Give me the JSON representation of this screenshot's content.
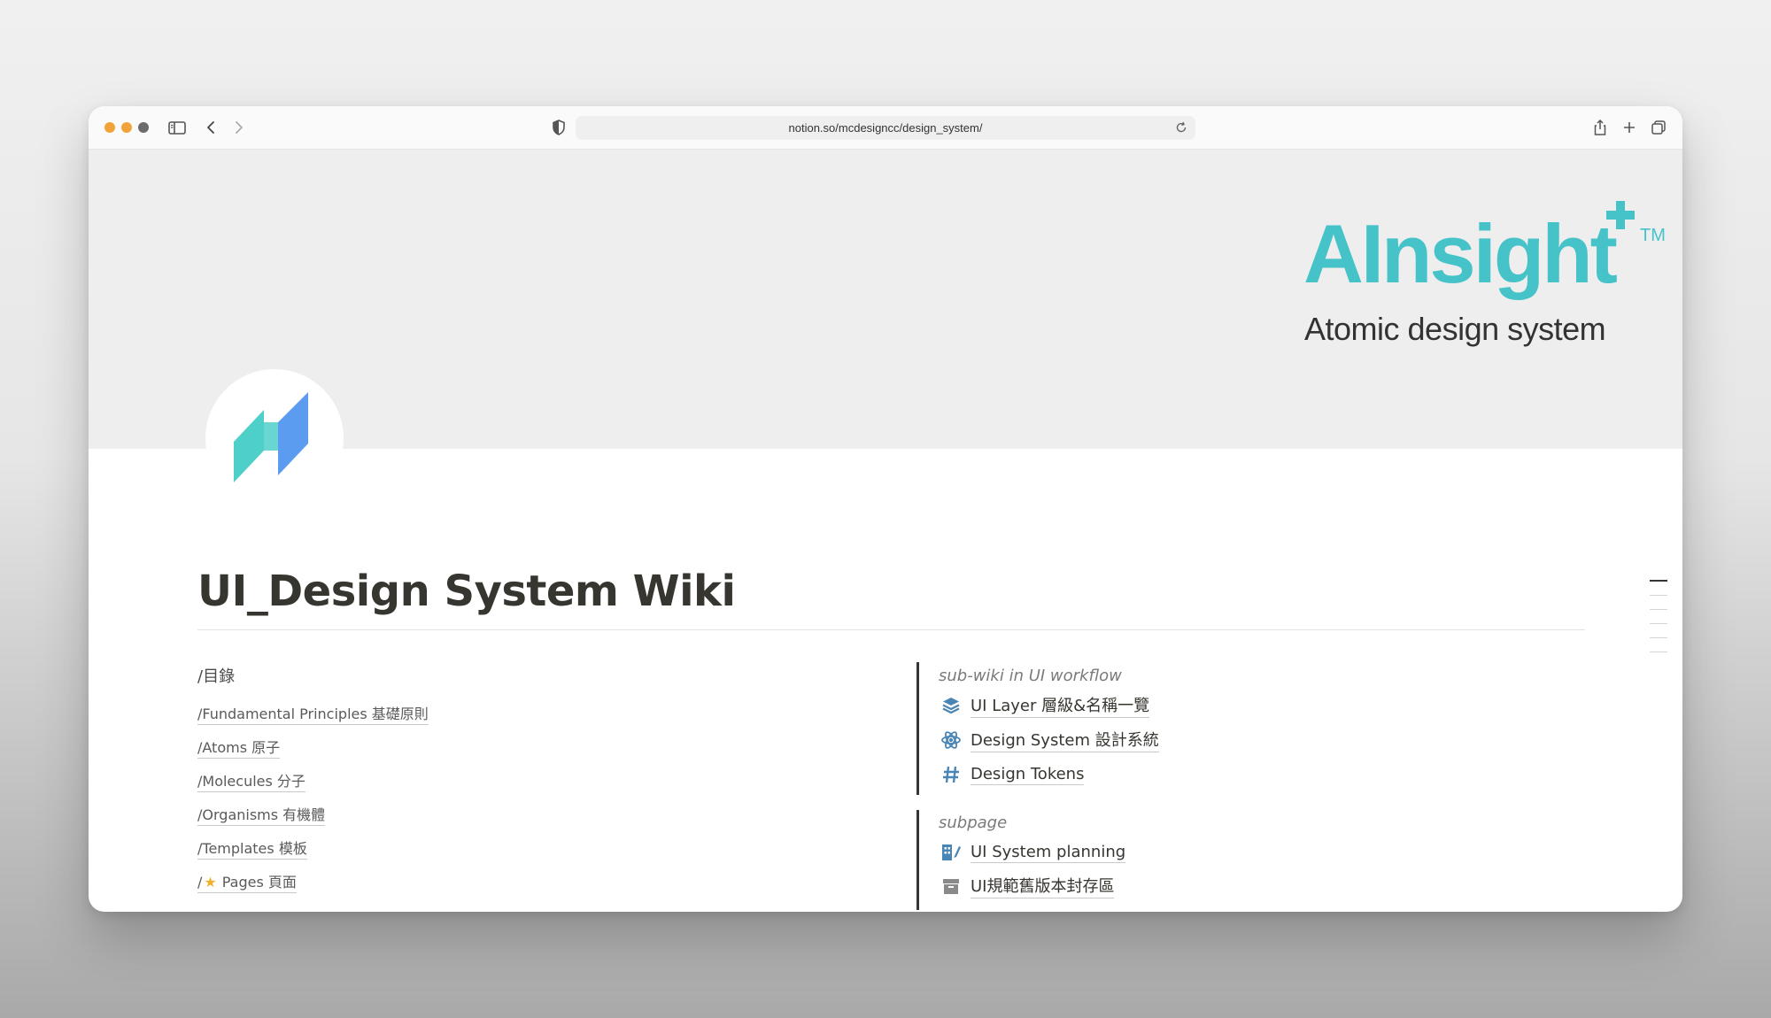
{
  "browser": {
    "url": "notion.so/mcdesigncc/design_system/"
  },
  "cover": {
    "brand_name": "AInsight",
    "brand_tm": "TM",
    "brand_subtitle": "Atomic design system",
    "brand_color": "#45c3c9"
  },
  "page": {
    "title": "UI_Design System Wiki"
  },
  "toc": {
    "heading": "/目錄",
    "items": [
      "/Fundamental Principles 基礎原則",
      "/Atoms 原子",
      "/Molecules 分子",
      "/Organisms 有機體",
      "/Templates 模板"
    ],
    "pages_prefix": "/",
    "pages_star": "★",
    "pages_label": "Pages 頁面"
  },
  "subwiki": {
    "label": "sub-wiki in UI workflow",
    "items": [
      {
        "label": "UI Layer 層級&名稱一覽",
        "icon": "layers-icon"
      },
      {
        "label": "Design System 設計系統",
        "icon": "atom-icon"
      },
      {
        "label": "Design Tokens",
        "icon": "hash-icon"
      }
    ]
  },
  "subpage": {
    "label": "subpage",
    "items": [
      {
        "label": "UI System planning",
        "icon": "building-pen-icon"
      },
      {
        "label": "UI規範舊版本封存區",
        "icon": "archive-icon"
      }
    ]
  },
  "icon_color": "#4a86b5"
}
